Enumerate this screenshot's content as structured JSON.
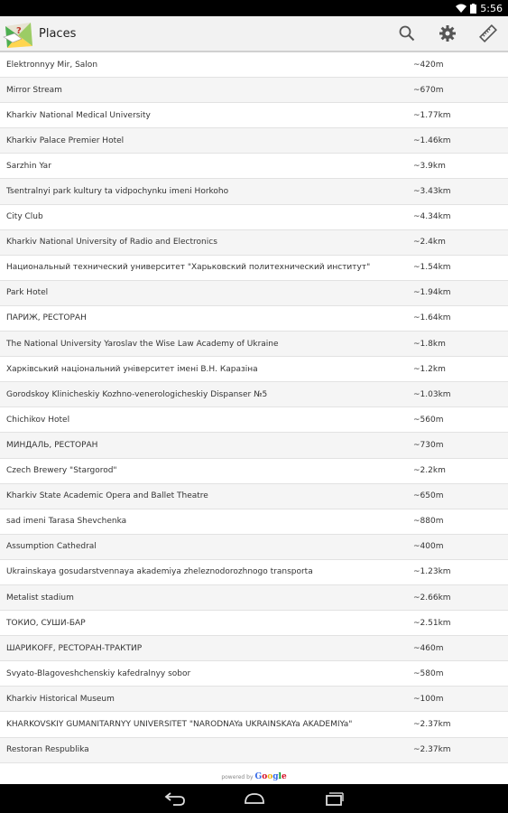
{
  "status": {
    "time": "5:56"
  },
  "app": {
    "title": "Places"
  },
  "places": [
    {
      "name": "Elektronnyy Mir, Salon",
      "distance": "~420m"
    },
    {
      "name": "Mirror Stream",
      "distance": "~670m"
    },
    {
      "name": "Kharkiv National Medical University",
      "distance": "~1.77km"
    },
    {
      "name": "Kharkiv Palace Premier Hotel",
      "distance": "~1.46km"
    },
    {
      "name": "Sarzhin Yar",
      "distance": "~3.9km"
    },
    {
      "name": "Tsentralnyi park kultury ta vidpochynku imeni Horkoho",
      "distance": "~3.43km"
    },
    {
      "name": "City Club",
      "distance": "~4.34km"
    },
    {
      "name": "Kharkiv National University of Radio and Electronics",
      "distance": "~2.4km"
    },
    {
      "name": "Национальный технический университет \"Харьковский политехнический институт\"",
      "distance": "~1.54km"
    },
    {
      "name": "Park Hotel",
      "distance": "~1.94km"
    },
    {
      "name": "ПАРИЖ, РЕСТОРАН",
      "distance": "~1.64km"
    },
    {
      "name": "The National University Yaroslav the Wise Law Academy of Ukraine",
      "distance": "~1.8km"
    },
    {
      "name": "Харківський національний університет імені В.Н. Каразіна",
      "distance": "~1.2km"
    },
    {
      "name": "Gorodskoy Klinicheskiy Kozhno-venerologicheskiy Dispanser №5",
      "distance": "~1.03km"
    },
    {
      "name": "Chichikov Hotel",
      "distance": "~560m"
    },
    {
      "name": "МИНДАЛЬ, РЕСТОРАН",
      "distance": "~730m"
    },
    {
      "name": "Czech Brewery \"Stargorod\"",
      "distance": "~2.2km"
    },
    {
      "name": "Kharkiv State Academic Opera and Ballet Theatre",
      "distance": "~650m"
    },
    {
      "name": "sad imeni Tarasa Shevchenka",
      "distance": "~880m"
    },
    {
      "name": "Assumption Cathedral",
      "distance": "~400m"
    },
    {
      "name": "Ukrainskaya gosudarstvennaya akademiya zheleznodorozhnogo transporta",
      "distance": "~1.23km"
    },
    {
      "name": "Metalist stadium",
      "distance": "~2.66km"
    },
    {
      "name": "ТОКИО, СУШИ-БАР",
      "distance": "~2.51km"
    },
    {
      "name": "ШАРИКОFF, РЕСТОРАН-ТРАКТИР",
      "distance": "~460m"
    },
    {
      "name": "Svyato-Blagoveshchenskiy kafedralnyy sobor",
      "distance": "~580m"
    },
    {
      "name": "Kharkiv Historical Museum",
      "distance": "~100m"
    },
    {
      "name": "KHARKOVSKIY GUMANITARNYY UNIVERSITET \"NARODNAYa UKRAINSKAYa AKADEMIYa\"",
      "distance": "~2.37km"
    },
    {
      "name": "Restoran Respublika",
      "distance": "~2.37km"
    }
  ],
  "footer": {
    "powered_by": "powered by",
    "brand": "Google"
  },
  "icons": {
    "app": "map-app-icon",
    "search": "search-icon",
    "settings": "gear-icon",
    "ruler": "ruler-icon",
    "back": "back-nav-icon",
    "home": "home-nav-icon",
    "recents": "recents-nav-icon"
  }
}
